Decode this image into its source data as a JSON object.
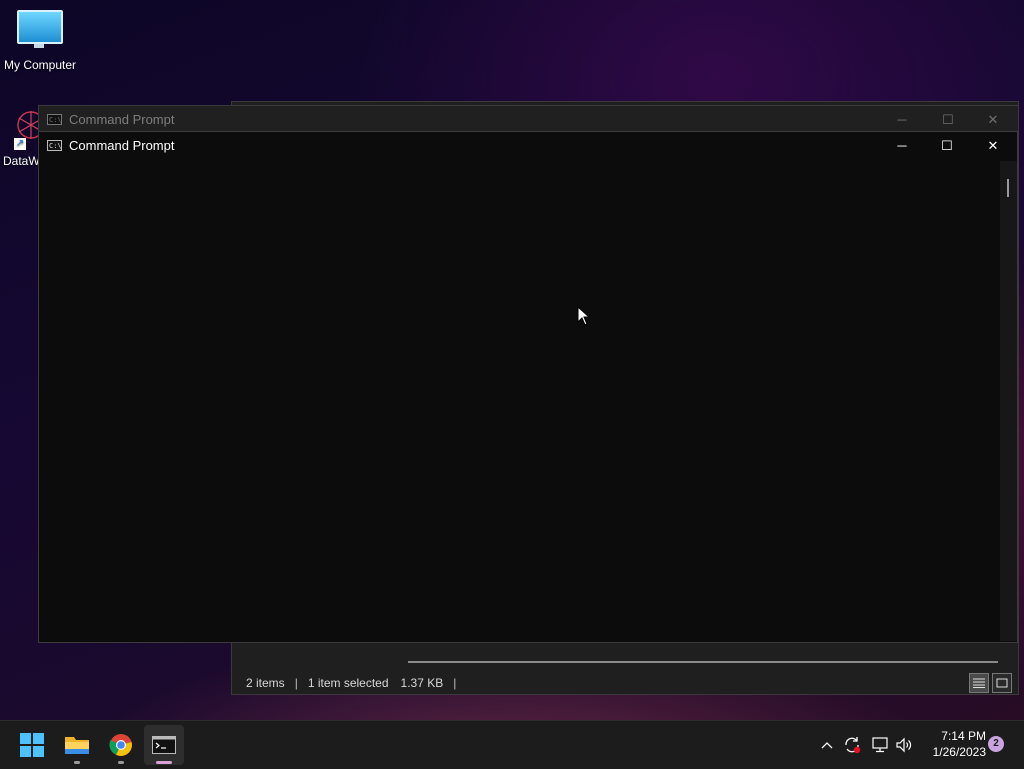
{
  "desktop": {
    "icons": [
      {
        "label": "My Computer"
      },
      {
        "label": "DataW"
      }
    ]
  },
  "explorer": {
    "status": {
      "items": "2 items",
      "selected": "1 item selected",
      "size": "1.37 KB"
    }
  },
  "cmd_back": {
    "title": "Command Prompt"
  },
  "cmd_front": {
    "title": "Command Prompt"
  },
  "window_controls": {
    "minimize": "─",
    "maximize": "☐",
    "close": "✕"
  },
  "taskbar": {
    "apps": [
      "start-icon",
      "file-explorer-icon",
      "chrome-icon",
      "terminal-icon"
    ],
    "clock": {
      "time": "7:14 PM",
      "date": "1/26/2023"
    },
    "notifications": "2"
  },
  "colors": {
    "taskbar": "#1c1c1c",
    "console_bg": "#0c0c0c",
    "active_indicator": "#d7a1d3"
  }
}
